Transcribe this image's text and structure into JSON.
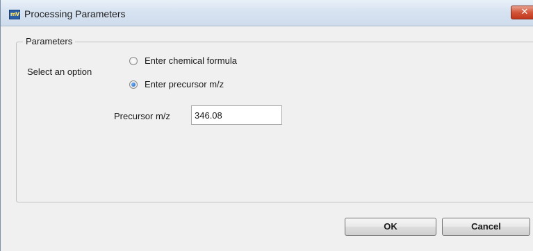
{
  "window": {
    "title": "Processing Parameters",
    "close_glyph": "✕",
    "app_icon_text": "mV"
  },
  "group": {
    "legend": "Parameters"
  },
  "select_option": {
    "label": "Select an option",
    "options": [
      {
        "label": "Enter chemical formula",
        "selected": false
      },
      {
        "label": "Enter precursor m/z",
        "selected": true
      }
    ]
  },
  "precursor": {
    "label": "Precursor m/z",
    "value": "346.08"
  },
  "buttons": {
    "ok": "OK",
    "cancel": "Cancel"
  },
  "colors": {
    "titlebar": "#d7e3f1",
    "close_button": "#c1381d",
    "window_bg": "#f0f0f0"
  }
}
